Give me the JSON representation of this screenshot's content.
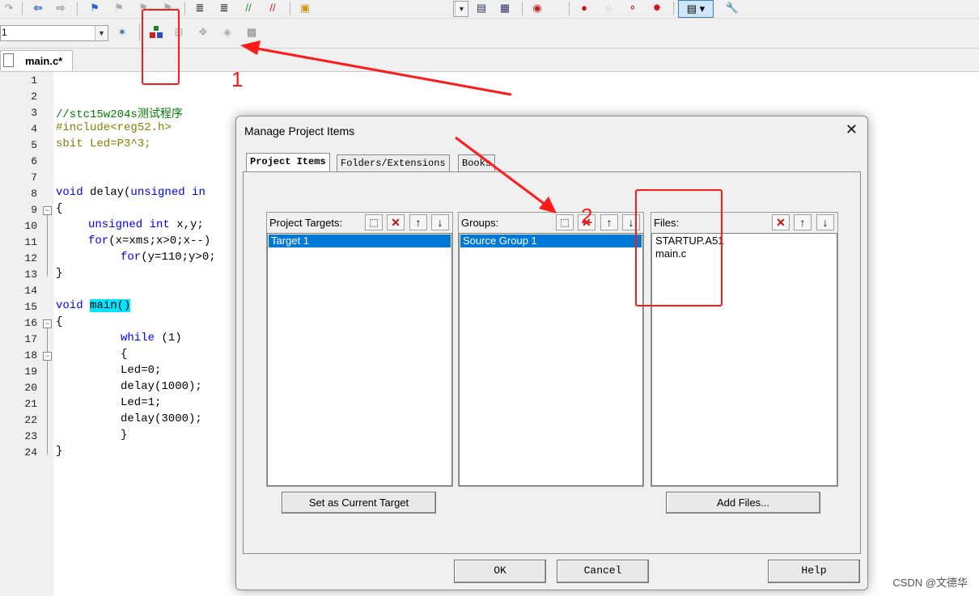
{
  "editor": {
    "tab_label": "main.c*",
    "target_combo_value": "1",
    "line_numbers": [
      "1",
      "2",
      "3",
      "4",
      "5",
      "6",
      "7",
      "8",
      "9",
      "10",
      "11",
      "12",
      "13",
      "14",
      "15",
      "16",
      "17",
      "18",
      "19",
      "20",
      "21",
      "22",
      "23",
      "24"
    ],
    "code": {
      "l3_comment": "//stc15w204s测试程序",
      "l4_include": "#include<reg52.h>",
      "l5_a": "sbit Led=P3^3;",
      "l8_kw": "void",
      "l8_fn": " delay(",
      "l8_kw2": "unsigned",
      "l8_tail": " in",
      "l9": "{",
      "l10_kw": "unsigned int",
      "l10_rest": " x,y;",
      "l11_kw": "for",
      "l11_rest": "(x=xms;x>0;x--)",
      "l12_kw": "for",
      "l12_rest": "(y=110;y>0;",
      "l13": "}",
      "l15_kw": "void",
      "l15_fn": "main()",
      "l16": "{",
      "l17_kw": "while",
      "l17_rest": " (1)",
      "l18": "{",
      "l19": "Led=0;",
      "l20": "delay(1000);",
      "l21": "Led=1;",
      "l22": "delay(3000);",
      "l23": "}",
      "l24": "}"
    }
  },
  "dialog": {
    "title": "Manage Project Items",
    "tabs": [
      "Project Items",
      "Folders/Extensions",
      "Books"
    ],
    "targets": {
      "label": "Project Targets:",
      "items": [
        "Target 1"
      ]
    },
    "groups": {
      "label": "Groups:",
      "items": [
        "Source Group 1"
      ]
    },
    "files": {
      "label": "Files:",
      "items": [
        "STARTUP.A51",
        "main.c"
      ]
    },
    "set_target_button": "Set as Current Target",
    "add_files_button": "Add Files...",
    "ok_button": "OK",
    "cancel_button": "Cancel",
    "help_button": "Help"
  },
  "annotations": {
    "marker_1": "1",
    "marker_2": "2",
    "color": "#ff1a1a"
  },
  "watermark": "CSDN @文德华"
}
